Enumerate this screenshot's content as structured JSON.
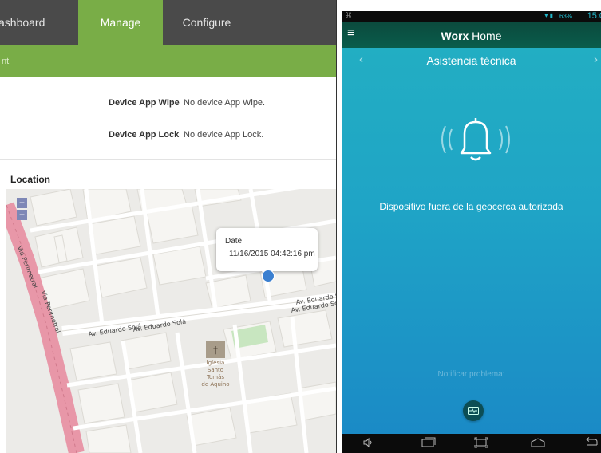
{
  "left": {
    "nav": {
      "dashboard": "ashboard",
      "manage": "Manage",
      "configure": "Configure"
    },
    "subbar_text": "nt",
    "device_app_wipe": {
      "label": "Device App Wipe",
      "value": "No device App Wipe."
    },
    "device_app_lock": {
      "label": "Device App Lock",
      "value": "No device App Lock."
    },
    "location_title": "Location",
    "map": {
      "zoom_in": "+",
      "zoom_out": "−",
      "popup": {
        "date_label": "Date:",
        "date_value": "11/16/2015 04:42:16 pm"
      },
      "streets": {
        "via_perimetral_1": "Via Perimetral",
        "via_perimetral_2": "Via Perimetral",
        "eduardo_sola_1": "Av. Eduardo Solá",
        "eduardo_sola_2": "Av. Eduardo Solá",
        "eduardo_sola_3": "Av. Eduardo S",
        "eduardo_sola_4": "Av. Eduardo Sol",
        "church": "Iglesia Santo\nTomás\nde Aquino"
      }
    }
  },
  "right": {
    "status": {
      "time": "15:0",
      "battery": "63%",
      "left_icon": "⌘"
    },
    "app_title_bold": "Worx",
    "app_title_rest": " Home",
    "header_title": "Asistencia técnica",
    "message": "Dispositivo fuera de la geocerca autorizada",
    "notify_label": "Notificar problema:",
    "icons": {
      "menu": "hamburger-icon",
      "prev": "chevron-left-icon",
      "next": "chevron-right-icon",
      "bell": "bell-icon",
      "notify": "pulse-icon"
    },
    "colors": {
      "gradient_top": "#23b0c2",
      "gradient_bottom": "#1a88c6",
      "appbar": "#0a5c4b",
      "manage_green": "#79ad47"
    }
  }
}
